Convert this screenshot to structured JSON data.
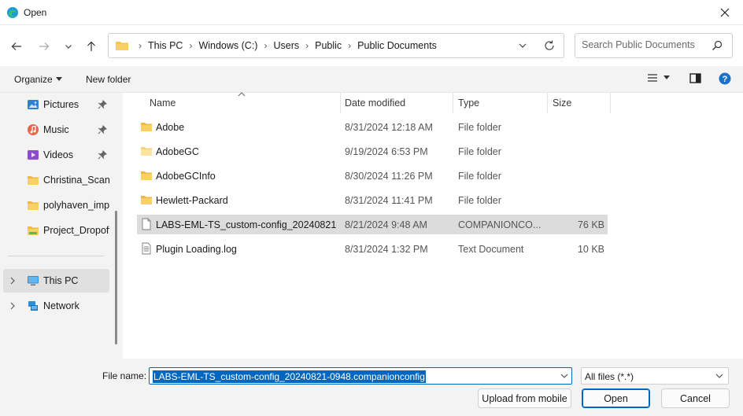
{
  "window": {
    "title": "Open"
  },
  "nav": {
    "back_label": "Back",
    "forward_label": "Forward",
    "recent_label": "Recent locations",
    "up_label": "Up"
  },
  "address": {
    "crumbs": [
      "This PC",
      "Windows (C:)",
      "Users",
      "Public",
      "Public Documents"
    ]
  },
  "search": {
    "placeholder": "Search Public Documents"
  },
  "toolbar": {
    "organize": "Organize",
    "new_folder": "New folder"
  },
  "sidebar": {
    "items": [
      {
        "label": "Pictures",
        "icon": "pictures-icon",
        "pinned": true
      },
      {
        "label": "Music",
        "icon": "music-icon",
        "pinned": true
      },
      {
        "label": "Videos",
        "icon": "videos-icon",
        "pinned": true
      },
      {
        "label": "Christina_Scan_I",
        "icon": "folder-icon",
        "pinned": false
      },
      {
        "label": "polyhaven_impo",
        "icon": "folder-icon",
        "pinned": false
      },
      {
        "label": "Project_Dropoff",
        "icon": "folder-icon",
        "pinned": false
      }
    ],
    "roots": [
      {
        "label": "This PC",
        "icon": "this-pc-icon",
        "selected": true
      },
      {
        "label": "Network",
        "icon": "network-icon",
        "selected": false
      }
    ]
  },
  "columns": {
    "name": "Name",
    "date": "Date modified",
    "type": "Type",
    "size": "Size"
  },
  "files": [
    {
      "name": "Adobe",
      "date": "8/31/2024 12:18 AM",
      "type": "File folder",
      "size": "",
      "kind": "folder"
    },
    {
      "name": "AdobeGC",
      "date": "9/19/2024 6:53 PM",
      "type": "File folder",
      "size": "",
      "kind": "folder-light"
    },
    {
      "name": "AdobeGCInfo",
      "date": "8/30/2024 11:26 PM",
      "type": "File folder",
      "size": "",
      "kind": "folder"
    },
    {
      "name": "Hewlett-Packard",
      "date": "8/31/2024 11:41 PM",
      "type": "File folder",
      "size": "",
      "kind": "folder"
    },
    {
      "name": "LABS-EML-TS_custom-config_20240821-...",
      "date": "8/21/2024 9:48 AM",
      "type": "COMPANIONCO...",
      "size": "76 KB",
      "kind": "file",
      "selected": true
    },
    {
      "name": "Plugin Loading.log",
      "date": "8/31/2024 1:32 PM",
      "type": "Text Document",
      "size": "10 KB",
      "kind": "text"
    }
  ],
  "bottom": {
    "file_name_label": "File name:",
    "file_name_value": "LABS-EML-TS_custom-config_20240821-0948.companionconfig",
    "file_type": "All files (*.*)",
    "upload_label": "Upload from mobile",
    "open_label": "Open",
    "cancel_label": "Cancel"
  },
  "colors": {
    "accent": "#0067c0",
    "folder": "#f7c74f",
    "selection": "#dcdcdc"
  }
}
